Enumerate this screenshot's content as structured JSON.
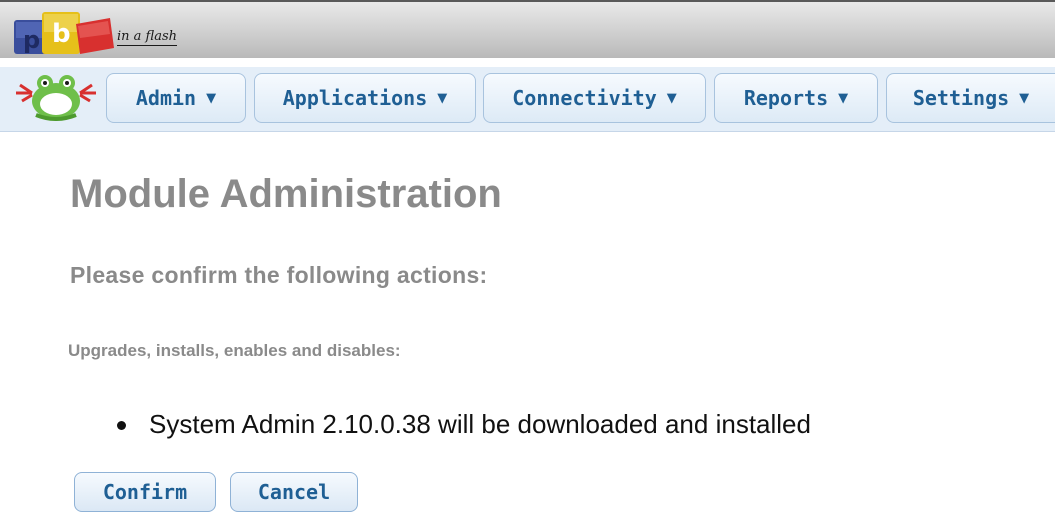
{
  "header": {
    "logo_letters": "pbx",
    "logo_tagline": "in a flash"
  },
  "nav": {
    "tabs": [
      {
        "label": "Admin"
      },
      {
        "label": "Applications"
      },
      {
        "label": "Connectivity"
      },
      {
        "label": "Reports"
      },
      {
        "label": "Settings"
      }
    ],
    "caret": "▼"
  },
  "main": {
    "title": "Module Administration",
    "subtitle": "Please confirm the following actions:",
    "section_label": "Upgrades, installs, enables and disables:",
    "actions": [
      "System Admin 2.10.0.38 will be downloaded and installed"
    ],
    "confirm_label": "Confirm",
    "cancel_label": "Cancel"
  },
  "colors": {
    "nav_text": "#1f5f94",
    "nav_bg": "#e4eef8",
    "heading_gray": "#8a8a8a"
  },
  "icons": {
    "brand_logo": "pbx-logo-icon",
    "mascot": "frog-icon",
    "dropdown": "caret-down-icon"
  }
}
